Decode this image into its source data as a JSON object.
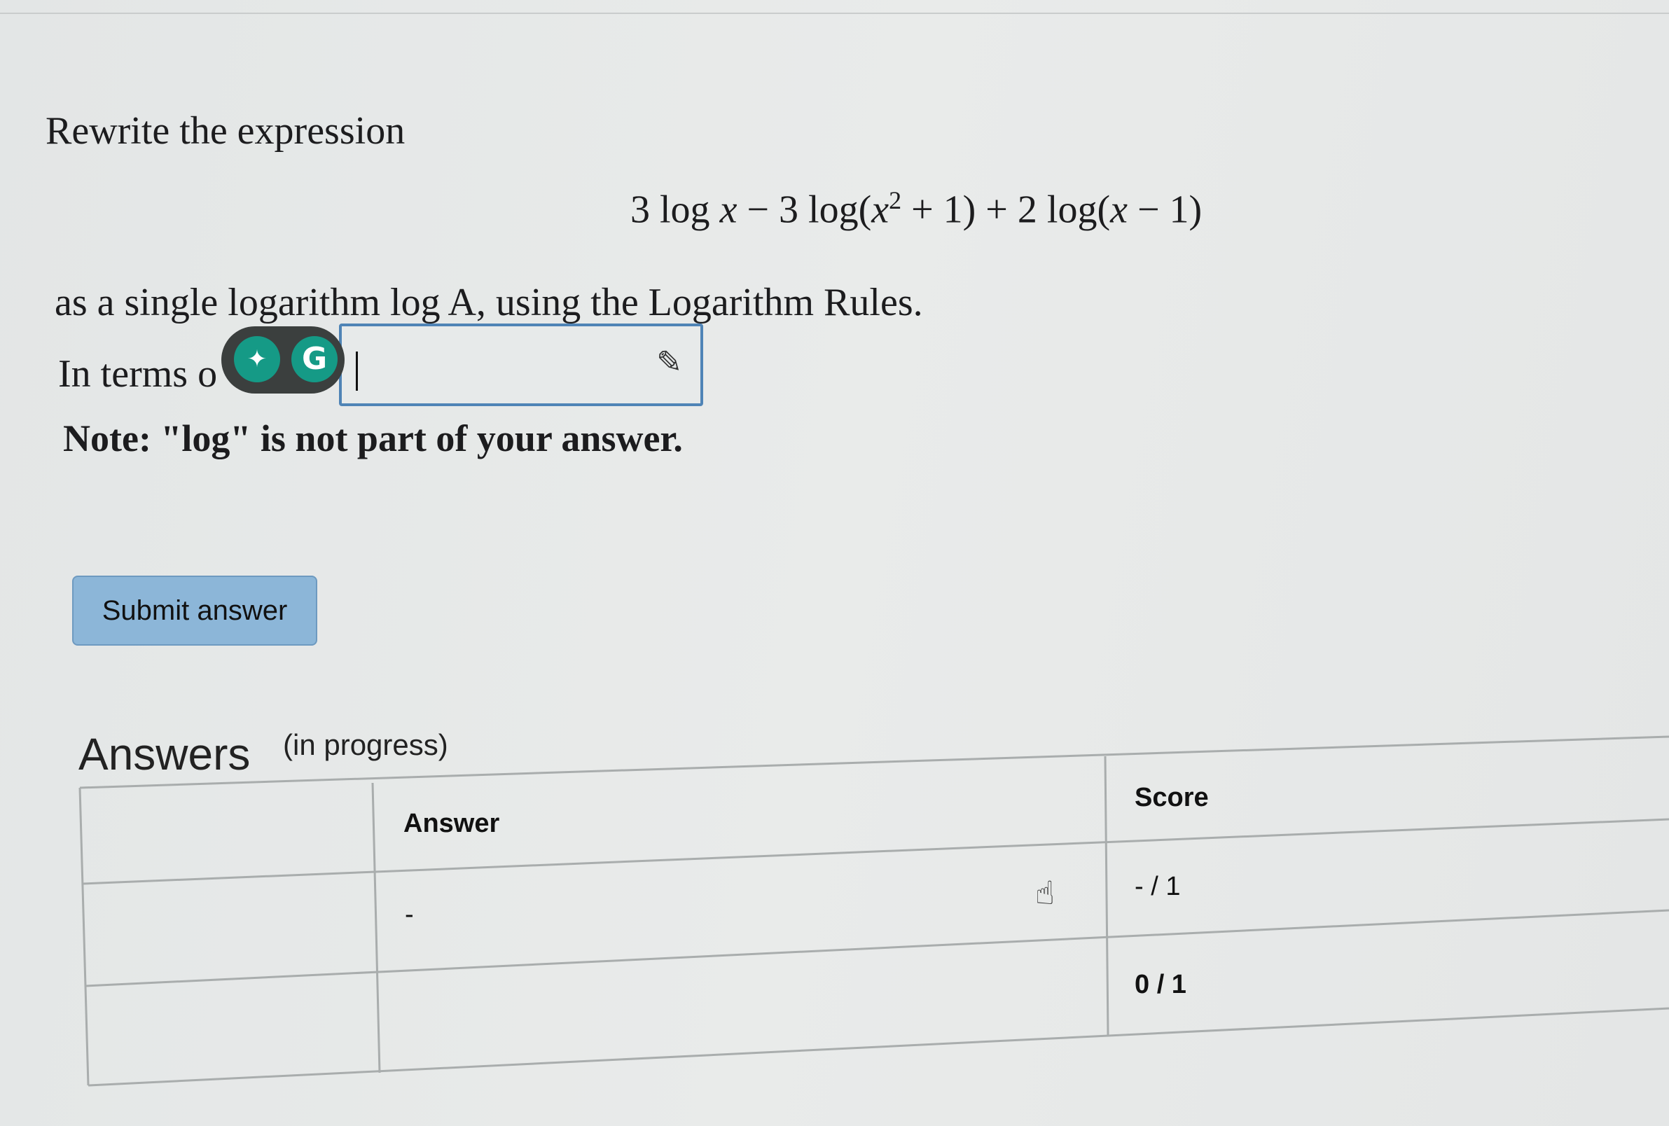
{
  "question": {
    "prompt": "Rewrite the expression",
    "expression_parts": {
      "a": "3 log ",
      "x1": "x",
      "b": " − 3 log(",
      "x2": "x",
      "exp": "2",
      "c": " + 1) + 2 log(",
      "x3": "x",
      "d": " − 1)"
    },
    "instruction": "as a single logarithm log A, using the Logarithm Rules.",
    "terms_prefix": "In terms o",
    "note": "Note: \"log\" is not part of your answer."
  },
  "answer_input": {
    "value": ""
  },
  "submit_label": "Submit answer",
  "answers": {
    "title": "Answers",
    "status": "(in progress)",
    "columns": [
      "",
      "Answer",
      "Score"
    ],
    "rows": [
      {
        "answer": "-",
        "score": "- / 1"
      },
      {
        "answer": "",
        "score": "0 / 1"
      }
    ]
  },
  "icons": {
    "grammarly_bulb": "✦",
    "grammarly_g": "G",
    "pencil": "✎",
    "hand": "☝"
  },
  "colors": {
    "input_border": "#4f84b6",
    "submit_bg": "#8cb6d8",
    "grammarly_green": "#159a86"
  }
}
